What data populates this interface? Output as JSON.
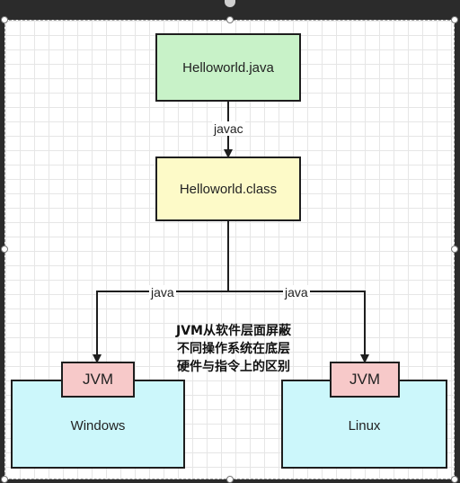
{
  "nodes": {
    "source": "Helloworld.java",
    "compiled": "Helloworld.class",
    "windows": "Windows",
    "linux": "Linux",
    "jvm_left": "JVM",
    "jvm_right": "JVM"
  },
  "edges": {
    "compile": "javac",
    "run_left": "java",
    "run_right": "java"
  },
  "note": {
    "lines": [
      "JVM从软件层面屏蔽",
      "不同操作系统在底层",
      "硬件与指令上的区别"
    ]
  },
  "colors": {
    "source_fill": "#c8f2c8",
    "compiled_fill": "#fdfac8",
    "os_fill": "#ccf7fb",
    "jvm_fill": "#f7c9c9"
  }
}
